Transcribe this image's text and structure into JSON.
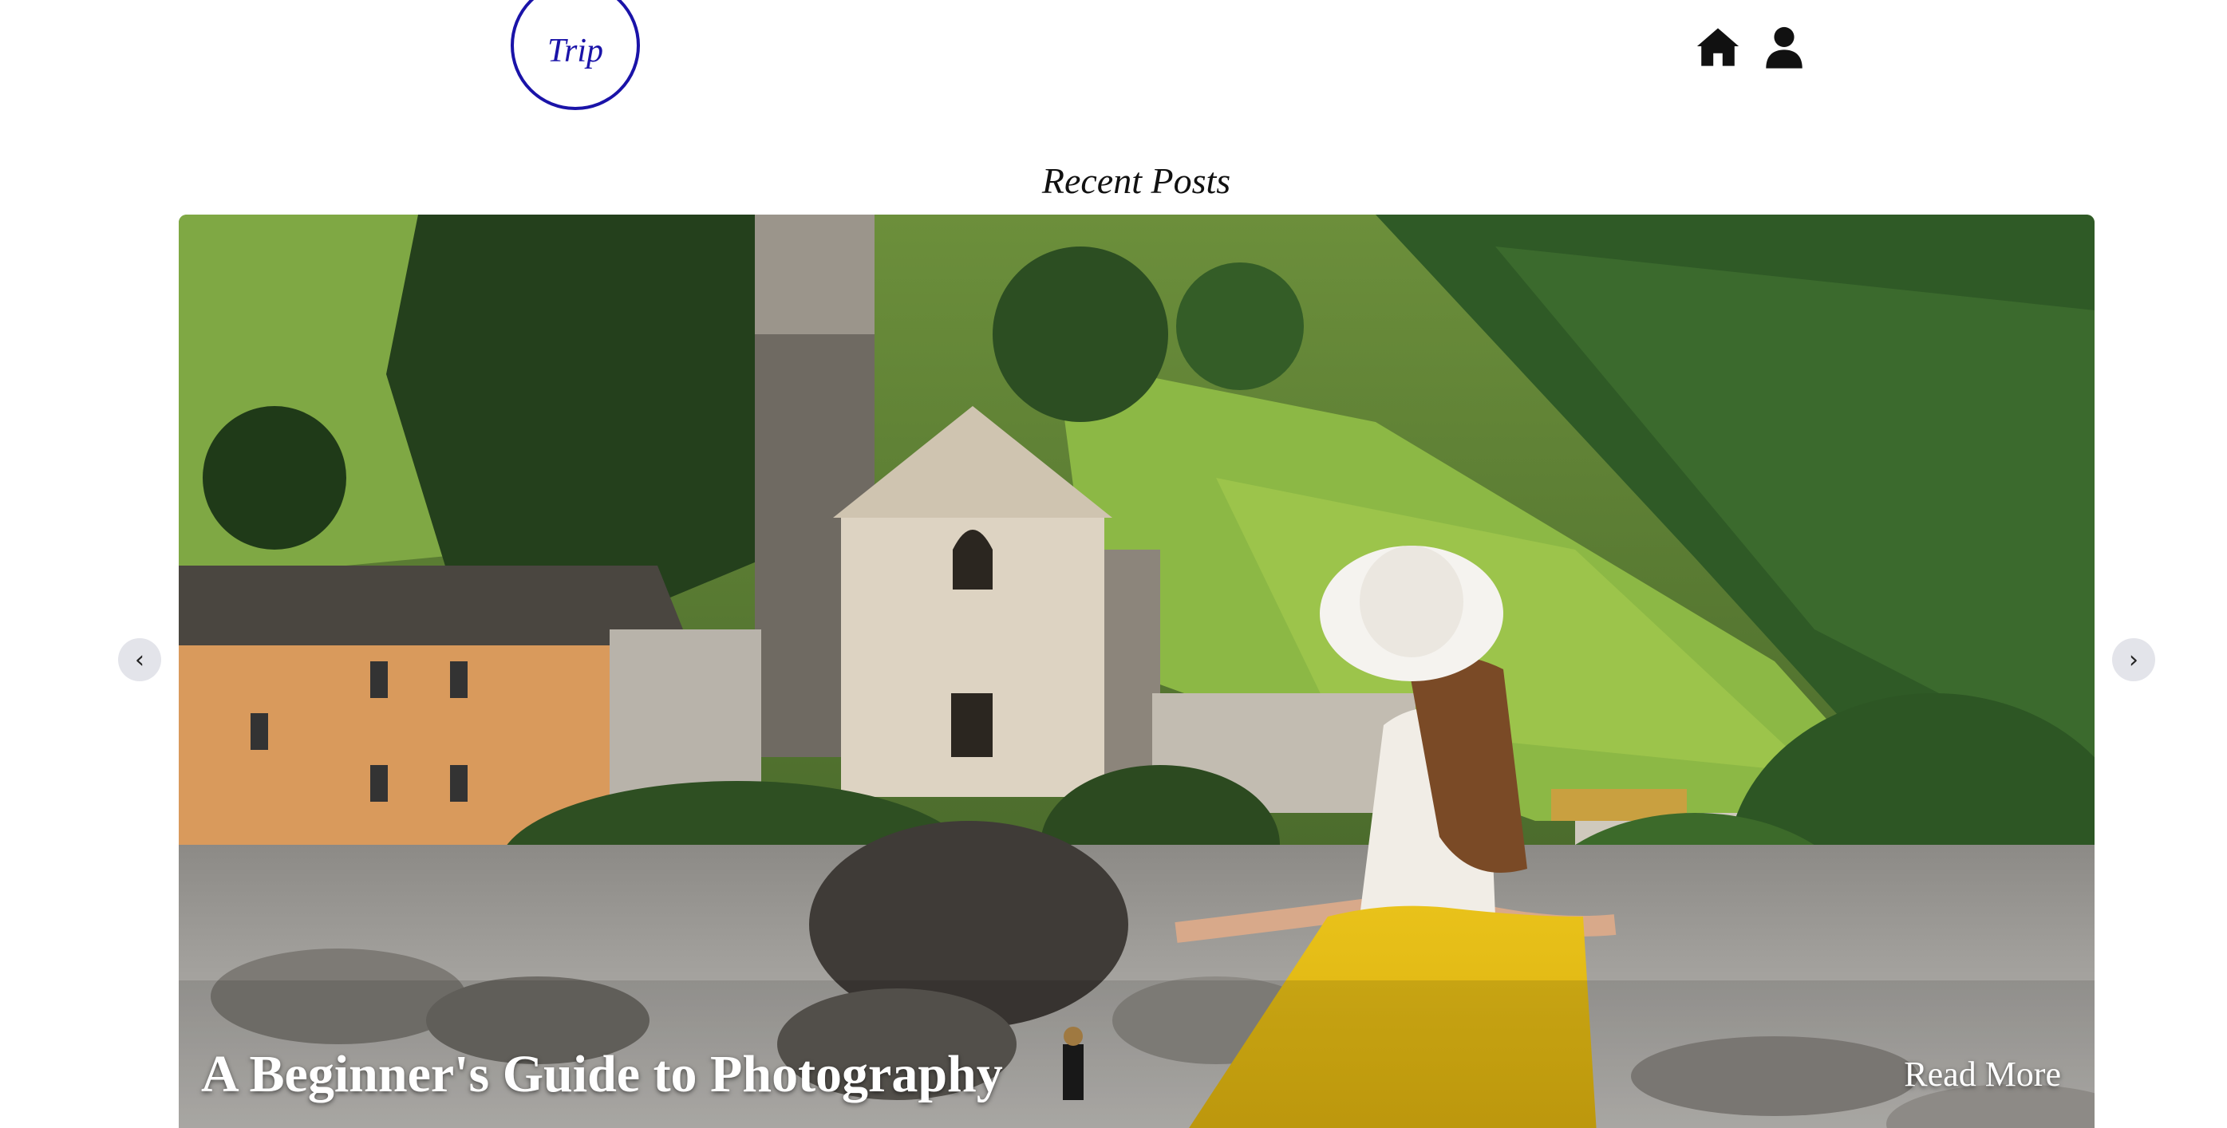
{
  "header": {
    "logo_text": "Trip",
    "icons": [
      "home-icon",
      "user-icon"
    ]
  },
  "section": {
    "title": "Recent Posts"
  },
  "carousel": {
    "slide_title": "A Beginner's Guide to Photography",
    "read_more_label": "Read More",
    "prev_label": "‹",
    "next_label": "›"
  },
  "colors": {
    "brand": "#1a13a8",
    "arrow_bg": "#e3e4ea",
    "caption_text": "#ffffff"
  }
}
